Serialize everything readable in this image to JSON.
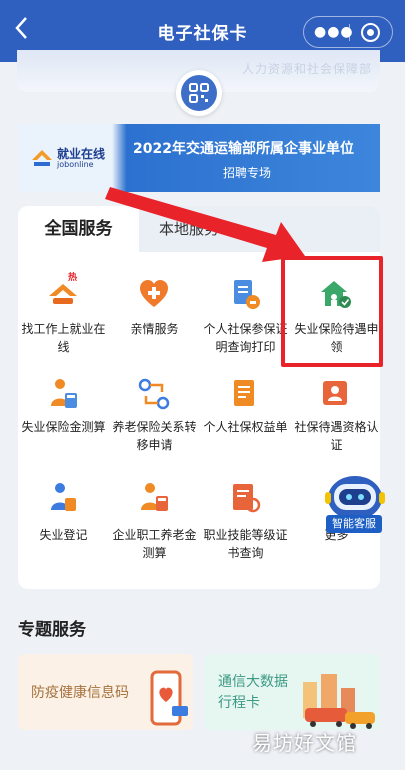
{
  "header": {
    "title": "电子社保卡",
    "back_icon": "chevron-left-icon",
    "more_icon": "more-dots-icon",
    "close_icon": "target-circle-icon",
    "bg_color": "#2f5fbf"
  },
  "card": {
    "org_text": "人力资源和社会保障部",
    "qr_icon": "qr-code-icon"
  },
  "banner": {
    "logo_name": "就业在线",
    "logo_sub": "jobonline",
    "title": "2022年交通运输部所属企事业单位",
    "subtitle": "招聘专场"
  },
  "tabs": [
    {
      "label": "全国服务",
      "active": true
    },
    {
      "label": "本地服务",
      "active": false
    }
  ],
  "services": [
    {
      "label": "找工作上就业在线",
      "icon": "job-search-icon",
      "badge": "热"
    },
    {
      "label": "亲情服务",
      "icon": "heart-plus-icon"
    },
    {
      "label": "个人社保参保证明查询打印",
      "icon": "print-certificate-icon"
    },
    {
      "label": "失业保险待遇申领",
      "icon": "unemployment-benefit-icon"
    },
    {
      "label": "失业保险金测算",
      "icon": "calculator-person-icon"
    },
    {
      "label": "养老保险关系转移申请",
      "icon": "transfer-route-icon"
    },
    {
      "label": "个人社保权益单",
      "icon": "rights-document-icon"
    },
    {
      "label": "社保待遇资格认证",
      "icon": "qualification-cert-icon"
    },
    {
      "label": "失业登记",
      "icon": "unemployment-register-icon"
    },
    {
      "label": "企业职工养老金测算",
      "icon": "pension-calc-icon"
    },
    {
      "label": "职业技能等级证书查询",
      "icon": "skill-certificate-icon"
    },
    {
      "label": "更多",
      "icon": "more-grid-icon"
    }
  ],
  "assistant": {
    "label": "智能客服",
    "icon": "robot-assistant-icon"
  },
  "special": {
    "title": "专题服务",
    "items": [
      {
        "label": "防疫健康信息码"
      },
      {
        "label_line1": "通信大数据",
        "label_line2": "行程卡"
      }
    ]
  },
  "watermark": "易坊好文馆",
  "colors": {
    "highlight": "#e8232a",
    "accent": "#2f5fbf",
    "icon_orange": "#f08a24",
    "icon_green": "#3aa868"
  }
}
